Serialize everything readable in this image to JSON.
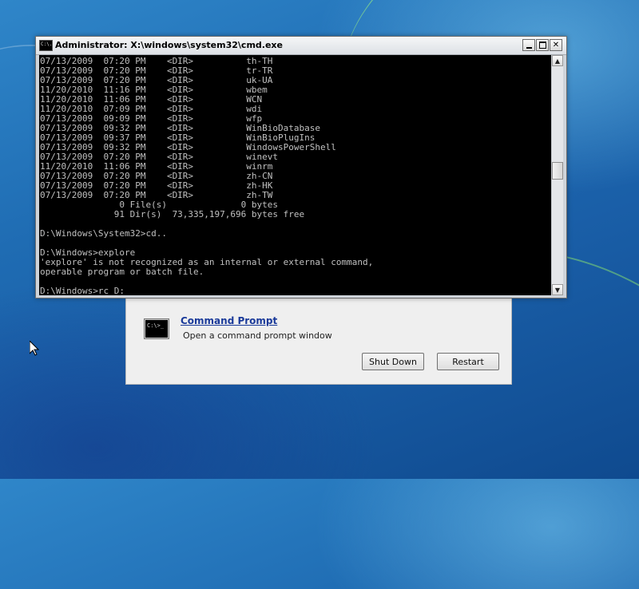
{
  "cmd_window": {
    "title": "Administrator: X:\\windows\\system32\\cmd.exe",
    "icon": "console-app-icon",
    "icon_glyph": "C:\\.",
    "buttons": {
      "minimize": "minimize-icon",
      "maximize": "maximize-icon",
      "close": "close-icon"
    },
    "console_lines": [
      "07/13/2009  07:20 PM    <DIR>          th-TH",
      "07/13/2009  07:20 PM    <DIR>          tr-TR",
      "07/13/2009  07:20 PM    <DIR>          uk-UA",
      "11/20/2010  11:16 PM    <DIR>          wbem",
      "11/20/2010  11:06 PM    <DIR>          WCN",
      "11/20/2010  07:09 PM    <DIR>          wdi",
      "07/13/2009  09:09 PM    <DIR>          wfp",
      "07/13/2009  09:32 PM    <DIR>          WinBioDatabase",
      "07/13/2009  09:37 PM    <DIR>          WinBioPlugIns",
      "07/13/2009  09:32 PM    <DIR>          WindowsPowerShell",
      "07/13/2009  07:20 PM    <DIR>          winevt",
      "11/20/2010  11:06 PM    <DIR>          winrm",
      "07/13/2009  07:20 PM    <DIR>          zh-CN",
      "07/13/2009  07:20 PM    <DIR>          zh-HK",
      "07/13/2009  07:20 PM    <DIR>          zh-TW",
      "               0 File(s)              0 bytes",
      "              91 Dir(s)  73,335,197,696 bytes free",
      "",
      "D:\\Windows\\System32>cd..",
      "",
      "D:\\Windows>explore",
      "'explore' is not recognized as an internal or external command,",
      "operable program or batch file.",
      "",
      "D:\\Windows>rc D:"
    ],
    "scrollbar": {
      "up": "up-arrow-icon",
      "down": "down-arrow-icon",
      "position": 0.48
    }
  },
  "recovery_dialog": {
    "item_icon": "command-prompt-icon",
    "item_icon_glyph": "C:\\>_",
    "item_title": "Command Prompt",
    "item_description": "Open a command prompt window",
    "shutdown_label": "Shut Down",
    "restart_label": "Restart"
  },
  "desktop": {
    "background": "windows-7-blue",
    "accent": "#1f6cb3"
  }
}
